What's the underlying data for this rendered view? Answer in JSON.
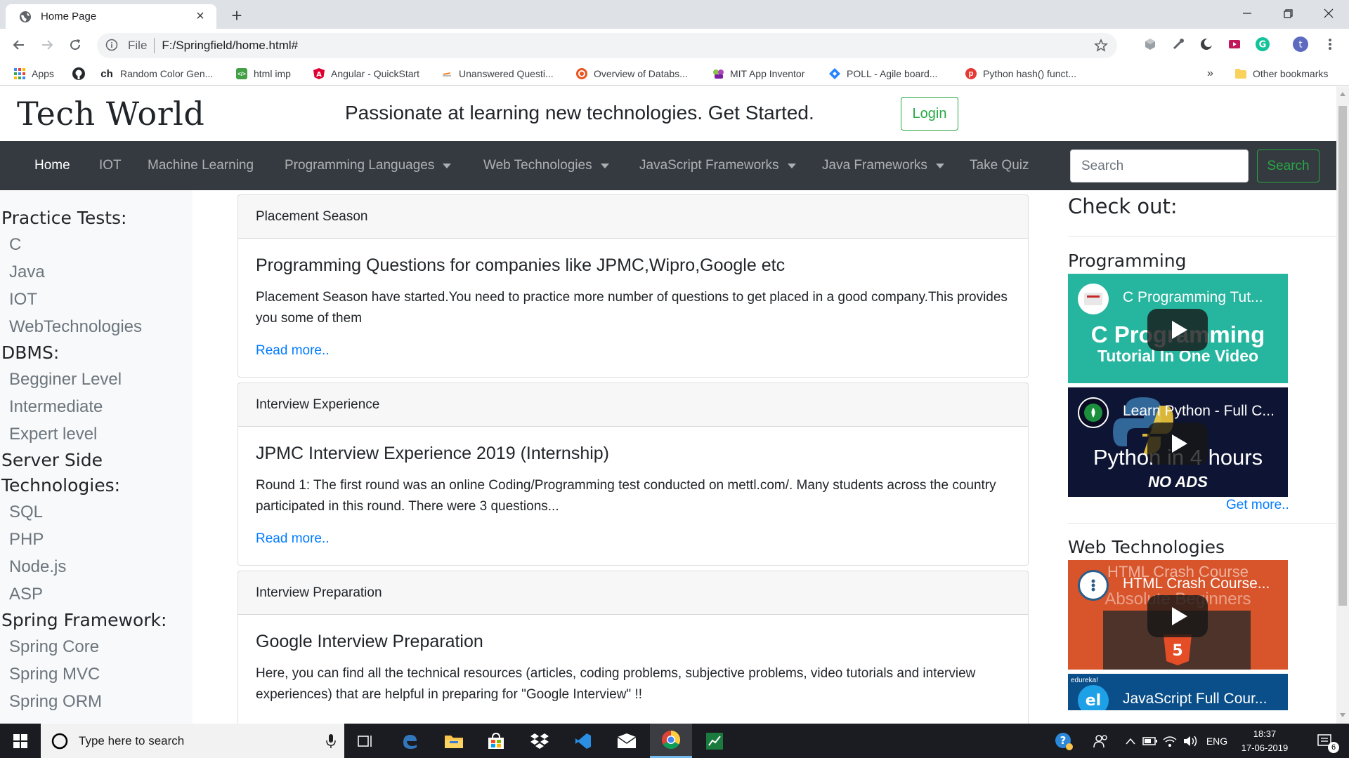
{
  "browser": {
    "tab_title": "Home Page",
    "url_scheme": "File",
    "url": "F:/Springfield/home.html#"
  },
  "bookmarks": [
    {
      "label": "Apps",
      "icon": "apps-grid-icon",
      "color": "#4285f4"
    },
    {
      "label": "",
      "icon": "github-icon",
      "color": "#24292e"
    },
    {
      "label": "Random Color Gen...",
      "icon": "ch-icon",
      "color": "#202124"
    },
    {
      "label": "html imp",
      "icon": "html-icon",
      "color": "#43a047"
    },
    {
      "label": "Angular - QuickStart",
      "icon": "angular-icon",
      "color": "#dd0031"
    },
    {
      "label": "Unanswered Questi...",
      "icon": "stackoverflow-icon",
      "color": "#f48024"
    },
    {
      "label": "Overview of Databs...",
      "icon": "ubuntu-icon",
      "color": "#e95420"
    },
    {
      "label": "MIT App Inventor",
      "icon": "appinventor-icon",
      "color": "#8bc34a"
    },
    {
      "label": "POLL - Agile board...",
      "icon": "jira-icon",
      "color": "#2684ff"
    },
    {
      "label": "Python hash() funct...",
      "icon": "programiz-icon",
      "color": "#e53935"
    }
  ],
  "bookmarks_more": "»",
  "other_bookmarks": "Other bookmarks",
  "header": {
    "brand": "Tech World",
    "tagline": "Passionate at learning new technologies. Get Started.",
    "login": "Login"
  },
  "nav": {
    "items": [
      {
        "label": "Home",
        "dropdown": false
      },
      {
        "label": "IOT",
        "dropdown": false
      },
      {
        "label": "Machine Learning",
        "dropdown": false
      },
      {
        "label": "Programming Languages",
        "dropdown": true
      },
      {
        "label": "Web Technologies",
        "dropdown": true
      },
      {
        "label": "JavaScript Frameworks",
        "dropdown": true
      },
      {
        "label": "Java Frameworks",
        "dropdown": true
      },
      {
        "label": "Take Quiz",
        "dropdown": false
      }
    ],
    "search_placeholder": "Search",
    "search_button": "Search"
  },
  "sidebar": {
    "practice": {
      "heading": "Practice Tests:",
      "links": [
        "C",
        "Java",
        "IOT",
        "WebTechnologies"
      ]
    },
    "dbms": {
      "heading": "DBMS:",
      "links": [
        "Begginer Level",
        "Intermediate",
        "Expert level"
      ]
    },
    "server": {
      "heading_line1": "Server Side",
      "heading_line2": "Technologies:",
      "links": [
        "SQL",
        "PHP",
        "Node.js",
        "ASP"
      ]
    },
    "spring": {
      "heading": "Spring Framework:",
      "links": [
        "Spring Core",
        "Spring MVC",
        "Spring ORM"
      ]
    }
  },
  "cards": [
    {
      "header": "Placement Season",
      "title": "Programming Questions for companies like JPMC,Wipro,Google etc",
      "text": "Placement Season have started.You need to practice more number of questions to get placed in a good company.This provides you some of them",
      "link": "Read more.."
    },
    {
      "header": "Interview Experience",
      "title": "JPMC Interview Experience 2019 (Internship)",
      "text": "Round 1: The first round was an online Coding/Programming test conducted on mettl.com/. Many students across the country participated in this round. There were 3 questions...",
      "link": "Read more.."
    },
    {
      "header": "Interview Preparation",
      "title": "Google Interview Preparation",
      "text": "Here, you can find all the technical resources (articles, coding problems, subjective problems, video tutorials and interview experiences) that are helpful in preparing for \"Google Interview\" !!",
      "link": ""
    }
  ],
  "right": {
    "checkout": "Check out:",
    "programming": {
      "title": "Programming",
      "videos": [
        {
          "title": "C Programming Tut...",
          "big1": "C Programming",
          "big2": "Tutorial In One Video",
          "bg": "#26b59e"
        },
        {
          "title": "Learn Python - Full C...",
          "big1": "Python in 4 hours",
          "big2": "NO ADS",
          "bg": "#0e1433"
        }
      ],
      "more": "Get more.."
    },
    "web": {
      "title": "Web Technologies",
      "videos": [
        {
          "title": "HTML Crash Course...",
          "overlay1": "HTML Crash Course",
          "overlay2": "Absolute Beginners",
          "bg": "#d8542a"
        },
        {
          "title": "JavaScript Full Cour...",
          "brand": "edureka!",
          "bg": "#0b4f8a"
        }
      ]
    }
  },
  "taskbar": {
    "search_placeholder": "Type here to search",
    "lang": "ENG",
    "time": "18:37",
    "date": "17-06-2019",
    "notifications": "6"
  },
  "colors": {
    "nav_bg": "#343a40",
    "success": "#28a745",
    "link": "#007bff",
    "sidebar_bg": "#f8f9fa"
  }
}
